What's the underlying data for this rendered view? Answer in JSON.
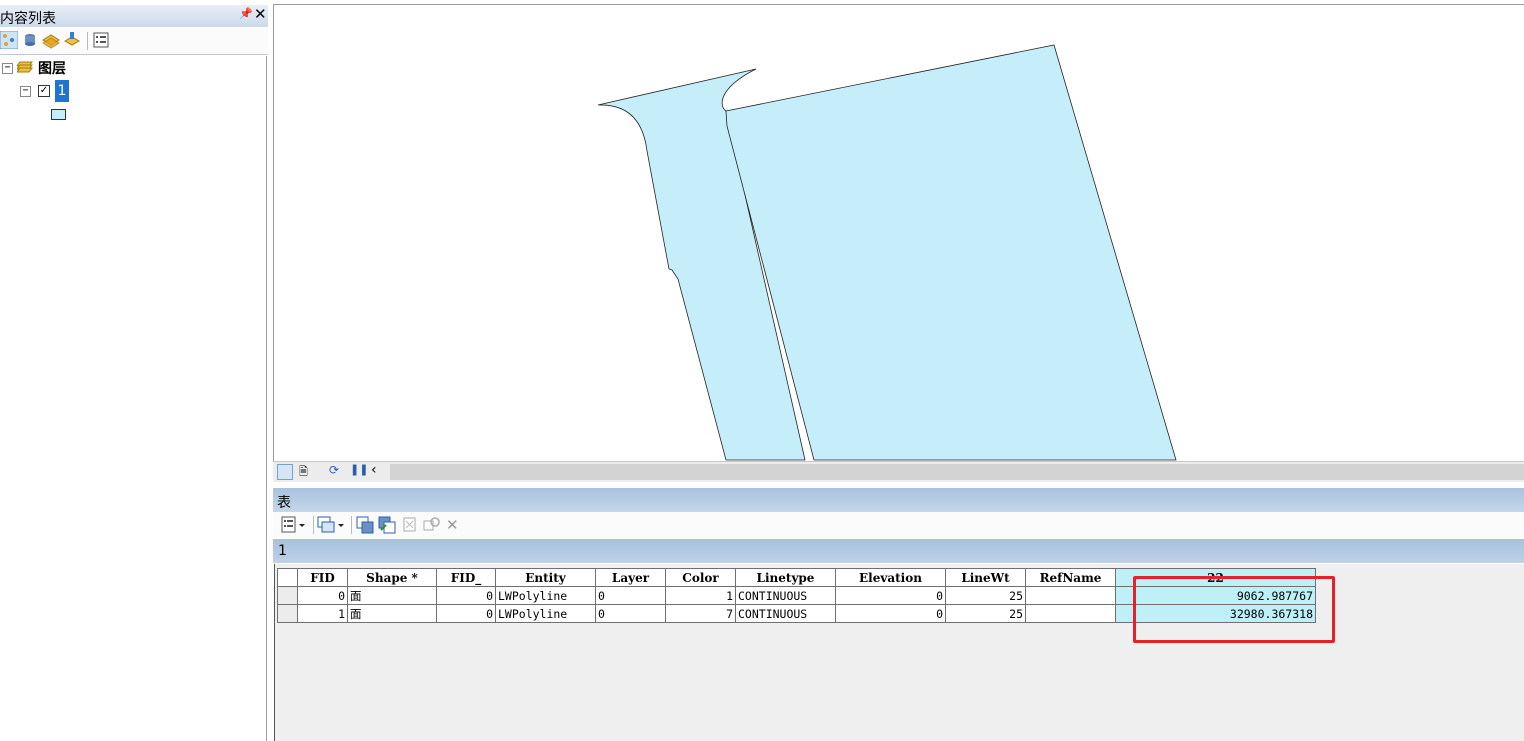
{
  "toc": {
    "title": "内容列表",
    "pin_icon": "pin-icon",
    "close_icon": "close-icon",
    "root_label": "图层",
    "root_expander": "−",
    "layer_label": "1",
    "layer_expander": "−",
    "layer_checked": "✓"
  },
  "table_window": {
    "title": "表",
    "tab_label": "1",
    "columns": [
      "FID",
      "Shape *",
      "FID_",
      "Entity",
      "Layer",
      "Color",
      "Linetype",
      "Elevation",
      "LineWt",
      "RefName",
      "22"
    ],
    "rows": [
      [
        "0",
        "面",
        "0",
        "LWPolyline",
        "0",
        "1",
        "CONTINUOUS",
        "0",
        "25",
        "",
        "9062.987767"
      ],
      [
        "1",
        "面",
        "0",
        "LWPolyline",
        "0",
        "7",
        "CONTINUOUS",
        "0",
        "25",
        "",
        "32980.367318"
      ]
    ]
  },
  "colors": {
    "polygon_fill": "#c6eefa",
    "highlight_box": "#e8202a",
    "panel_title": "#cdd9ea"
  }
}
